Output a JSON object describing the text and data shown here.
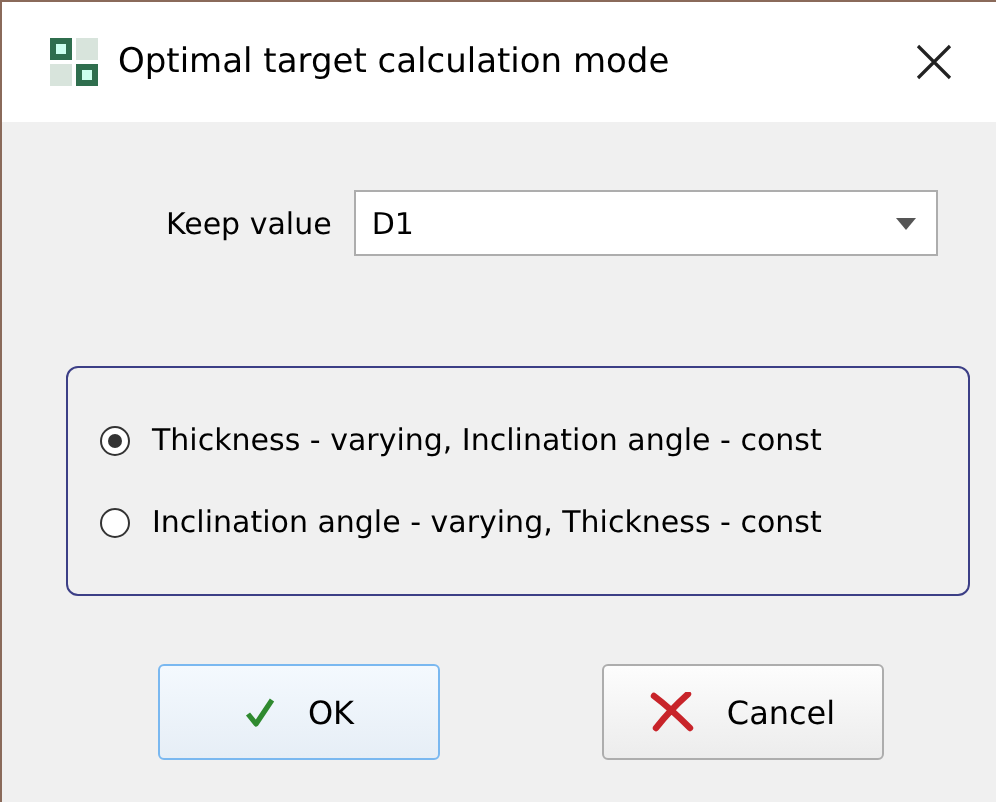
{
  "window": {
    "title": "Optimal target calculation mode"
  },
  "keep_value": {
    "label": "Keep value",
    "value": "D1"
  },
  "modes": [
    {
      "label": "Thickness - varying, Inclination angle - const",
      "selected": true
    },
    {
      "label": "Inclination angle - varying, Thickness - const",
      "selected": false
    }
  ],
  "buttons": [
    {
      "kind": "ok",
      "label": "OK",
      "focused": true
    },
    {
      "kind": "cancel",
      "label": "Cancel",
      "focused": false
    }
  ]
}
